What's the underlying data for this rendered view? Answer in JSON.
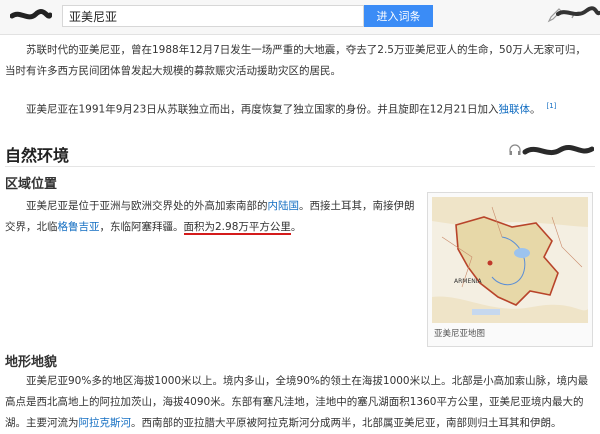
{
  "header": {
    "search_value": "亚美尼亚",
    "search_button": "进入词条"
  },
  "intro": {
    "p1": "苏联时代的亚美尼亚，曾在1988年12月7日发生一场严重的大地震，夺去了2.5万亚美尼亚人的生命，50万人无家可归，当时有许多西方民间团体曾发起大规模的募款赈灾活动援助灾区的居民。",
    "p2_a": "亚美尼亚在1991年9月23日从苏联独立而出，再度恢复了独立国家的身份。并且旋即在12月21日加入",
    "p2_link": "独联体",
    "p2_b": "。",
    "p2_ref": "[1]"
  },
  "section": {
    "title": "自然环境"
  },
  "location": {
    "title": "区域位置",
    "p_a": "亚美尼亚是位于亚洲与欧洲交界处的外高加索南部的",
    "p_link1": "内陆国",
    "p_b": "。西接土耳其，南接伊朗交界，北临",
    "p_link2": "格鲁吉亚",
    "p_c": "，东临阿塞拜疆。",
    "p_area": "面积为2.98万平方公里",
    "p_d": "。"
  },
  "map": {
    "caption": "亚美尼亚地图",
    "label": "ARMENIA",
    "fill_color": "#e7d8a8",
    "border_color": "#b8442a"
  },
  "terrain": {
    "title": "地形地貌",
    "p_a": "亚美尼亚90%多的地区海拔1000米以上。境内多山，全境90%的领土在海拔1000米以上。北部是小高加索山脉，境内最高点是西北高地上的阿拉加茨山，海拔4090米。东部有塞凡洼地，洼地中的塞凡湖面积1360平方公里，亚美尼亚境内最大的湖。主要河流为",
    "p_link": "阿拉克斯河",
    "p_b": "。西南部的亚拉腊大平原被阿拉克斯河分成两半，北部属亚美尼亚，南部则归土耳其和伊朗。"
  },
  "colors": {
    "accent": "#3b8cf6",
    "link": "#136ec2",
    "highlight": "#d41b1b"
  },
  "icons": [
    "headphones-icon",
    "scribble-mark"
  ]
}
